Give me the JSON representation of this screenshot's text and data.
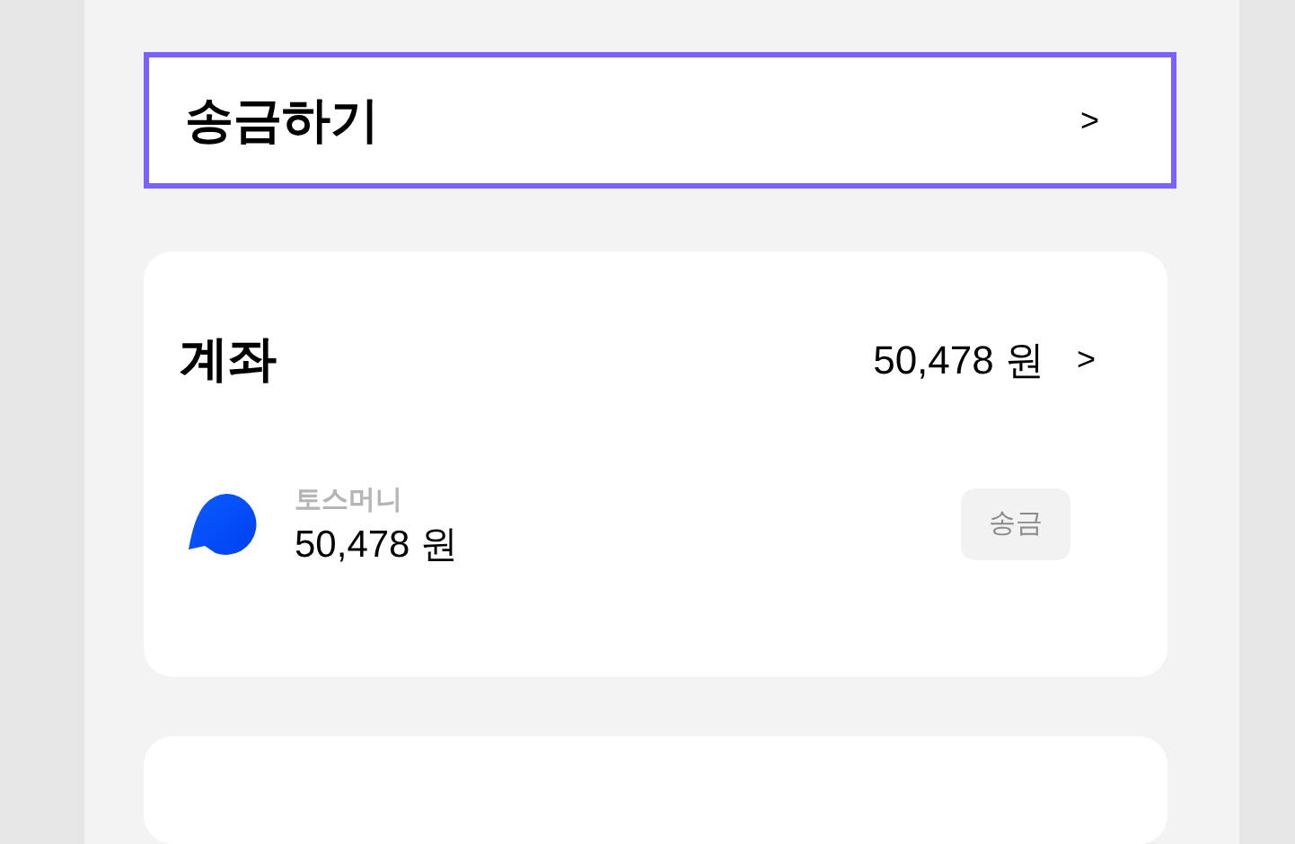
{
  "transfer_card": {
    "title": "송금하기",
    "chevron": ">",
    "focused": true
  },
  "account_card": {
    "title": "계좌",
    "total": "50,478 원",
    "chevron": ">",
    "accounts": [
      {
        "name": "토스머니",
        "balance": "50,478 원",
        "action": "송금"
      }
    ]
  }
}
